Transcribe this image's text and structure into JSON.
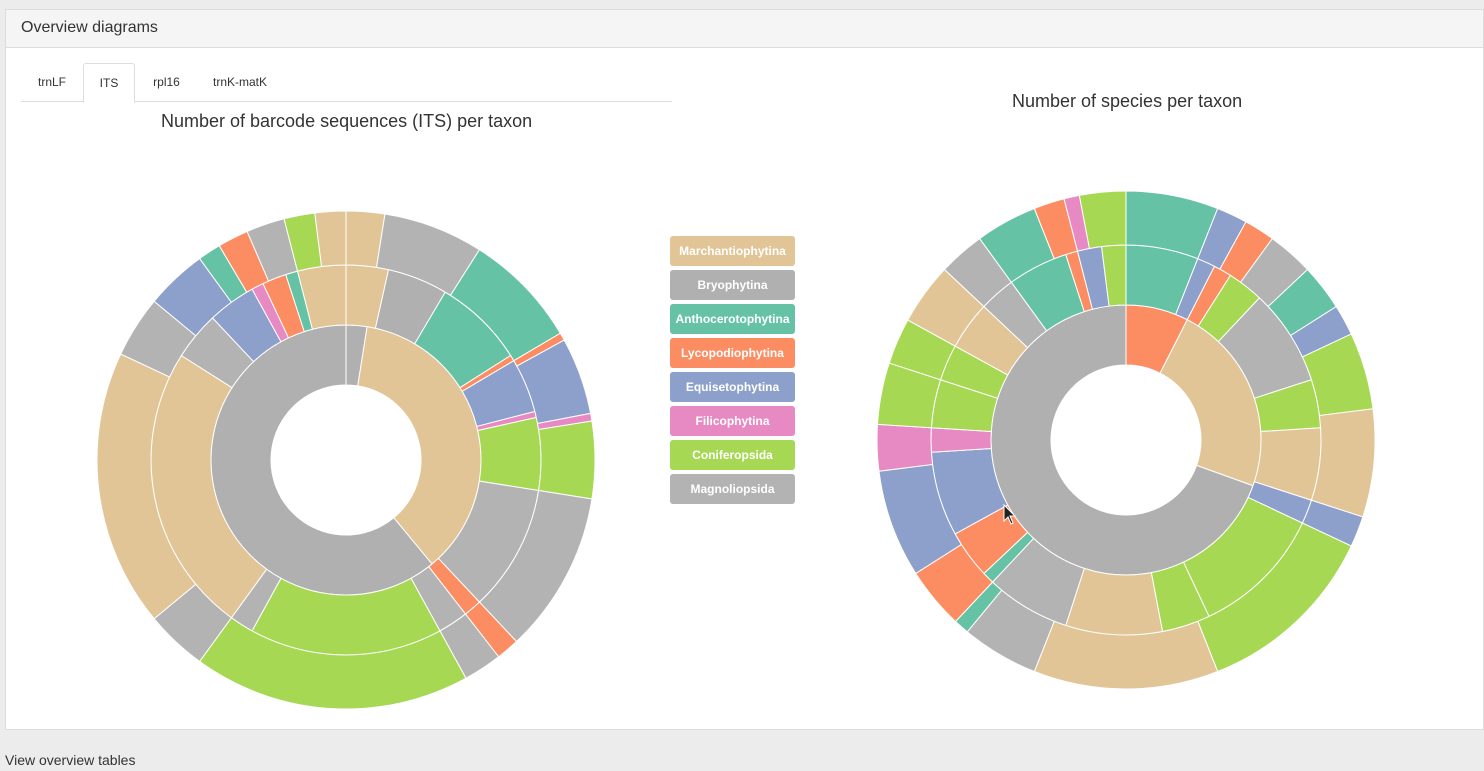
{
  "panel": {
    "title": "Overview diagrams"
  },
  "tabs": [
    {
      "label": "trnLF",
      "active": false
    },
    {
      "label": "ITS",
      "active": true
    },
    {
      "label": "rpl16",
      "active": false
    },
    {
      "label": "trnK-matK",
      "active": false
    }
  ],
  "legend": [
    {
      "label": "Marchantiophytina",
      "color": "#e2c597"
    },
    {
      "label": "Bryophytina",
      "color": "#b0b0b0"
    },
    {
      "label": "Anthocerotophytina",
      "color": "#66c2a5"
    },
    {
      "label": "Lycopodiophytina",
      "color": "#fc8d62"
    },
    {
      "label": "Equisetophytina",
      "color": "#8da0cb"
    },
    {
      "label": "Filicophytina",
      "color": "#e78ac3"
    },
    {
      "label": "Coniferopsida",
      "color": "#a6d854"
    },
    {
      "label": "Magnoliopsida",
      "color": "#b3b3b3"
    }
  ],
  "chart_data": [
    {
      "type": "sunburst",
      "title": "Number of barcode sequences (ITS) per taxon",
      "rings": [
        [
          [
            "Bryophytina",
            0.0,
            0.025
          ],
          [
            "Marchantiophytina",
            0.025,
            0.39
          ],
          [
            "Bryophytina",
            0.39,
            1.0
          ]
        ],
        [
          [
            "Marchantiophytina",
            0.0,
            0.035
          ],
          [
            "Bryophytina",
            0.035,
            0.085
          ],
          [
            "Anthocerotophytina",
            0.085,
            0.16
          ],
          [
            "Lycopodiophytina",
            0.16,
            0.165
          ],
          [
            "Equisetophytina",
            0.165,
            0.21
          ],
          [
            "Filicophytina",
            0.21,
            0.215
          ],
          [
            "Coniferopsida",
            0.215,
            0.275
          ],
          [
            "Magnoliopsida",
            0.275,
            0.38
          ],
          [
            "Lycopodiophytina",
            0.38,
            0.395
          ],
          [
            "Magnoliopsida",
            0.395,
            0.42
          ],
          [
            "Coniferopsida",
            0.42,
            0.58
          ],
          [
            "Magnoliopsida",
            0.58,
            0.6
          ],
          [
            "Marchantiophytina",
            0.6,
            0.84
          ],
          [
            "Magnoliopsida",
            0.84,
            0.88
          ],
          [
            "Equisetophytina",
            0.88,
            0.92
          ],
          [
            "Filicophytina",
            0.92,
            0.93
          ],
          [
            "Lycopodiophytina",
            0.93,
            0.95
          ],
          [
            "Anthocerotophytina",
            0.95,
            0.96
          ],
          [
            "Marchantiophytina",
            0.96,
            1.0
          ]
        ],
        [
          [
            "Marchantiophytina",
            0.0,
            0.025
          ],
          [
            "Magnoliopsida",
            0.025,
            0.09
          ],
          [
            "Anthocerotophytina",
            0.09,
            0.165
          ],
          [
            "Lycopodiophytina",
            0.165,
            0.17
          ],
          [
            "Equisetophytina",
            0.17,
            0.22
          ],
          [
            "Filicophytina",
            0.22,
            0.225
          ],
          [
            "Coniferopsida",
            0.225,
            0.275
          ],
          [
            "Magnoliopsida",
            0.275,
            0.38
          ],
          [
            "Lycopodiophytina",
            0.38,
            0.395
          ],
          [
            "Magnoliopsida",
            0.395,
            0.42
          ],
          [
            "Coniferopsida",
            0.42,
            0.6
          ],
          [
            "Magnoliopsida",
            0.6,
            0.64
          ],
          [
            "Marchantiophytina",
            0.64,
            0.82
          ],
          [
            "Magnoliopsida",
            0.82,
            0.86
          ],
          [
            "Equisetophytina",
            0.86,
            0.9
          ],
          [
            "Anthocerotophytina",
            0.9,
            0.915
          ],
          [
            "Lycopodiophytina",
            0.915,
            0.935
          ],
          [
            "Magnoliopsida",
            0.935,
            0.96
          ],
          [
            "Coniferopsida",
            0.96,
            0.98
          ],
          [
            "Marchantiophytina",
            0.98,
            1.0
          ]
        ]
      ]
    },
    {
      "type": "sunburst",
      "title": "Number of species per taxon",
      "rings": [
        [
          [
            "Lycopodiophytina",
            0.0,
            0.075
          ],
          [
            "Marchantiophytina",
            0.075,
            0.305
          ],
          [
            "Bryophytina",
            0.305,
            1.0
          ]
        ],
        [
          [
            "Anthocerotophytina",
            0.0,
            0.06
          ],
          [
            "Equisetophytina",
            0.06,
            0.075
          ],
          [
            "Lycopodiophytina",
            0.075,
            0.09
          ],
          [
            "Coniferopsida",
            0.09,
            0.12
          ],
          [
            "Magnoliopsida",
            0.12,
            0.2
          ],
          [
            "Coniferopsida",
            0.2,
            0.24
          ],
          [
            "Marchantiophytina",
            0.24,
            0.3
          ],
          [
            "Equisetophytina",
            0.3,
            0.32
          ],
          [
            "Coniferopsida",
            0.32,
            0.43
          ],
          [
            "Coniferopsida",
            0.43,
            0.47
          ],
          [
            "Marchantiophytina",
            0.47,
            0.55
          ],
          [
            "Magnoliopsida",
            0.55,
            0.62
          ],
          [
            "Anthocerotophytina",
            0.62,
            0.63
          ],
          [
            "Lycopodiophytina",
            0.63,
            0.67
          ],
          [
            "Equisetophytina",
            0.67,
            0.74
          ],
          [
            "Filicophytina",
            0.74,
            0.76
          ],
          [
            "Coniferopsida",
            0.76,
            0.8
          ],
          [
            "Coniferopsida",
            0.8,
            0.83
          ],
          [
            "Marchantiophytina",
            0.83,
            0.87
          ],
          [
            "Magnoliopsida",
            0.87,
            0.9
          ],
          [
            "Anthocerotophytina",
            0.9,
            0.95
          ],
          [
            "Lycopodiophytina",
            0.95,
            0.96
          ],
          [
            "Equisetophytina",
            0.96,
            0.98
          ],
          [
            "Coniferopsida",
            0.98,
            1.0
          ]
        ],
        [
          [
            "Anthocerotophytina",
            0.0,
            0.06
          ],
          [
            "Equisetophytina",
            0.06,
            0.08
          ],
          [
            "Lycopodiophytina",
            0.08,
            0.1
          ],
          [
            "Magnoliopsida",
            0.1,
            0.13
          ],
          [
            "Anthocerotophytina",
            0.13,
            0.16
          ],
          [
            "Equisetophytina",
            0.16,
            0.18
          ],
          [
            "Coniferopsida",
            0.18,
            0.23
          ],
          [
            "Marchantiophytina",
            0.23,
            0.3
          ],
          [
            "Equisetophytina",
            0.3,
            0.32
          ],
          [
            "Coniferopsida",
            0.32,
            0.44
          ],
          [
            "Marchantiophytina",
            0.44,
            0.56
          ],
          [
            "Magnoliopsida",
            0.56,
            0.61
          ],
          [
            "Anthocerotophytina",
            0.61,
            0.62
          ],
          [
            "Lycopodiophytina",
            0.62,
            0.66
          ],
          [
            "Equisetophytina",
            0.66,
            0.73
          ],
          [
            "Filicophytina",
            0.73,
            0.76
          ],
          [
            "Coniferopsida",
            0.76,
            0.8
          ],
          [
            "Coniferopsida",
            0.8,
            0.83
          ],
          [
            "Marchantiophytina",
            0.83,
            0.87
          ],
          [
            "Magnoliopsida",
            0.87,
            0.9
          ],
          [
            "Anthocerotophytina",
            0.9,
            0.94
          ],
          [
            "Lycopodiophytina",
            0.94,
            0.96
          ],
          [
            "Filicophytina",
            0.96,
            0.97
          ],
          [
            "Coniferopsida",
            0.97,
            1.0
          ]
        ]
      ]
    }
  ],
  "footer": {
    "link": "View overview tables"
  }
}
